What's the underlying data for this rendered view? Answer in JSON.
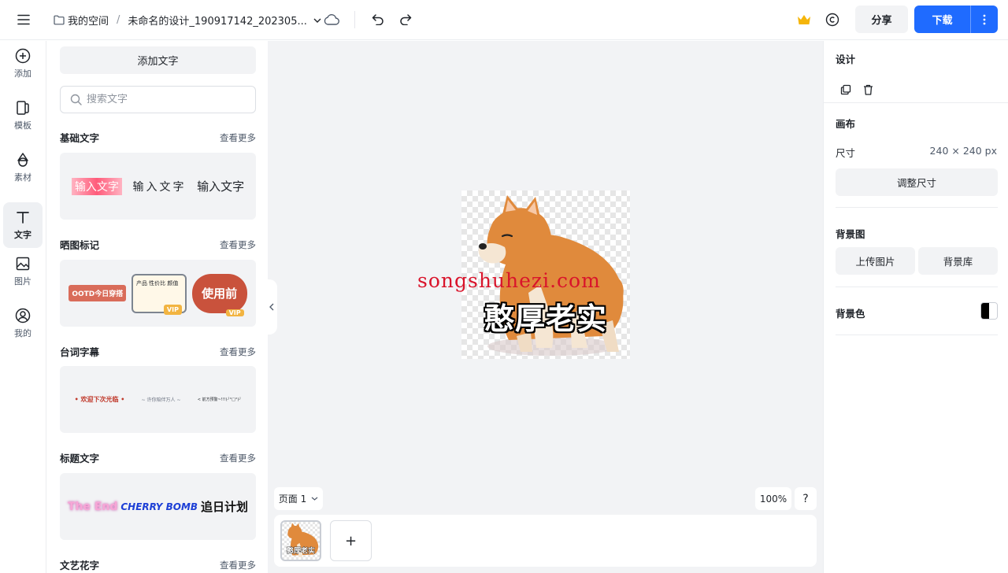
{
  "header": {
    "breadcrumb_root": "我的空间",
    "breadcrumb_separator": "/",
    "doc_title": "未命名的设计_190917142_202305...",
    "share_label": "分享",
    "download_label": "下载",
    "brand_color": "#1f6bff",
    "crown_color": "#f5b50a"
  },
  "rail": {
    "items": [
      {
        "label": "添加",
        "icon": "plus-circle-icon"
      },
      {
        "label": "模板",
        "icon": "template-icon"
      },
      {
        "label": "素材",
        "icon": "shapes-icon"
      },
      {
        "label": "文字",
        "icon": "text-icon",
        "active": true
      },
      {
        "label": "图片",
        "icon": "image-icon"
      },
      {
        "label": "我的",
        "icon": "user-icon"
      }
    ]
  },
  "panel": {
    "add_text_label": "添加文字",
    "search_placeholder": "搜索文字",
    "more_label": "查看更多",
    "sections": [
      {
        "title": "基础文字",
        "samples": [
          "输入文字",
          "输入文字",
          "输入文字"
        ]
      },
      {
        "title": "晒图标记",
        "samples": [
          "OOTD今日穿搭",
          "产品 性价比 颜值",
          "使用前"
        ],
        "badge": "VIP"
      },
      {
        "title": "台词字幕",
        "samples": [
          "• 欢迎下次光临 •",
          "~ 许你陪伴万人 ~",
          "< 前方预警~!!!(╯°□°)╯"
        ]
      },
      {
        "title": "标题文字",
        "samples": [
          "The End",
          "CHERRY BOMB",
          "追日计划"
        ]
      },
      {
        "title": "文艺花字",
        "samples": []
      }
    ]
  },
  "canvas": {
    "caption_text": "憨厚老实",
    "watermark_text": "songshuhezi.com",
    "page_selector_label": "页面 1",
    "zoom_label": "100%",
    "help_label": "?",
    "add_page_label": "+"
  },
  "right_panel": {
    "design_title": "设计",
    "canvas_title": "画布",
    "size_label": "尺寸",
    "size_value": "240 × 240 px",
    "resize_label": "调整尺寸",
    "bg_image_title": "背景图",
    "upload_label": "上传图片",
    "library_label": "背景库",
    "bg_color_title": "背景色"
  }
}
